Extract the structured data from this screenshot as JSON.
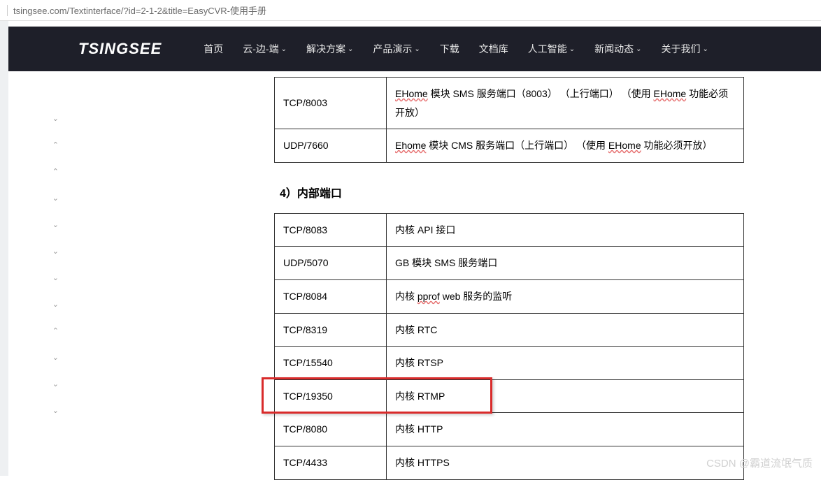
{
  "url": "tsingsee.com/Textinterface/?id=2-1-2&title=EasyCVR-使用手册",
  "logo": "TSINGSEE",
  "nav": [
    {
      "label": "首页",
      "dropdown": false
    },
    {
      "label": "云-边-端",
      "dropdown": true
    },
    {
      "label": "解决方案",
      "dropdown": true
    },
    {
      "label": "产品演示",
      "dropdown": true
    },
    {
      "label": "下载",
      "dropdown": false
    },
    {
      "label": "文档库",
      "dropdown": false
    },
    {
      "label": "人工智能",
      "dropdown": true
    },
    {
      "label": "新闻动态",
      "dropdown": true
    },
    {
      "label": "关于我们",
      "dropdown": true
    }
  ],
  "table1": {
    "rows": [
      {
        "port": "TCP/8003",
        "desc_parts": [
          "EHome",
          " 模块 SMS 服务端口（8003） （上行端口） （使用 ",
          "EHome",
          " 功能必须开放）"
        ],
        "wavy_indices": [
          0,
          2
        ]
      },
      {
        "port": "UDP/7660",
        "desc_parts": [
          "Ehome",
          " 模块 CMS 服务端口（上行端口） （使用 ",
          "EHome",
          " 功能必须开放）"
        ],
        "wavy_indices": [
          0,
          2
        ]
      }
    ]
  },
  "section_heading": "4）内部端口",
  "table2": {
    "rows": [
      {
        "port": "TCP/8083",
        "desc": "内核 API 接口",
        "highlight": false
      },
      {
        "port": "UDP/5070",
        "desc": "GB 模块 SMS 服务端口",
        "highlight": false
      },
      {
        "port": "TCP/8084",
        "desc_parts": [
          "内核 ",
          "pprof",
          " web 服务的监听"
        ],
        "wavy_indices": [
          1
        ],
        "highlight": false
      },
      {
        "port": "TCP/8319",
        "desc": "内核 RTC",
        "highlight": false
      },
      {
        "port": "TCP/15540",
        "desc": "内核 RTSP",
        "highlight": false
      },
      {
        "port": "TCP/19350",
        "desc": "内核 RTMP",
        "highlight": true
      },
      {
        "port": "TCP/8080",
        "desc": "内核 HTTP",
        "highlight": false
      },
      {
        "port": "TCP/4433",
        "desc": "内核 HTTPS",
        "highlight": false
      }
    ]
  },
  "watermark": "CSDN @霸道流氓气质",
  "sidebar_arrows": [
    "down",
    "up",
    "up",
    "down",
    "down",
    "down",
    "down",
    "down",
    "up",
    "down",
    "down",
    "down"
  ]
}
